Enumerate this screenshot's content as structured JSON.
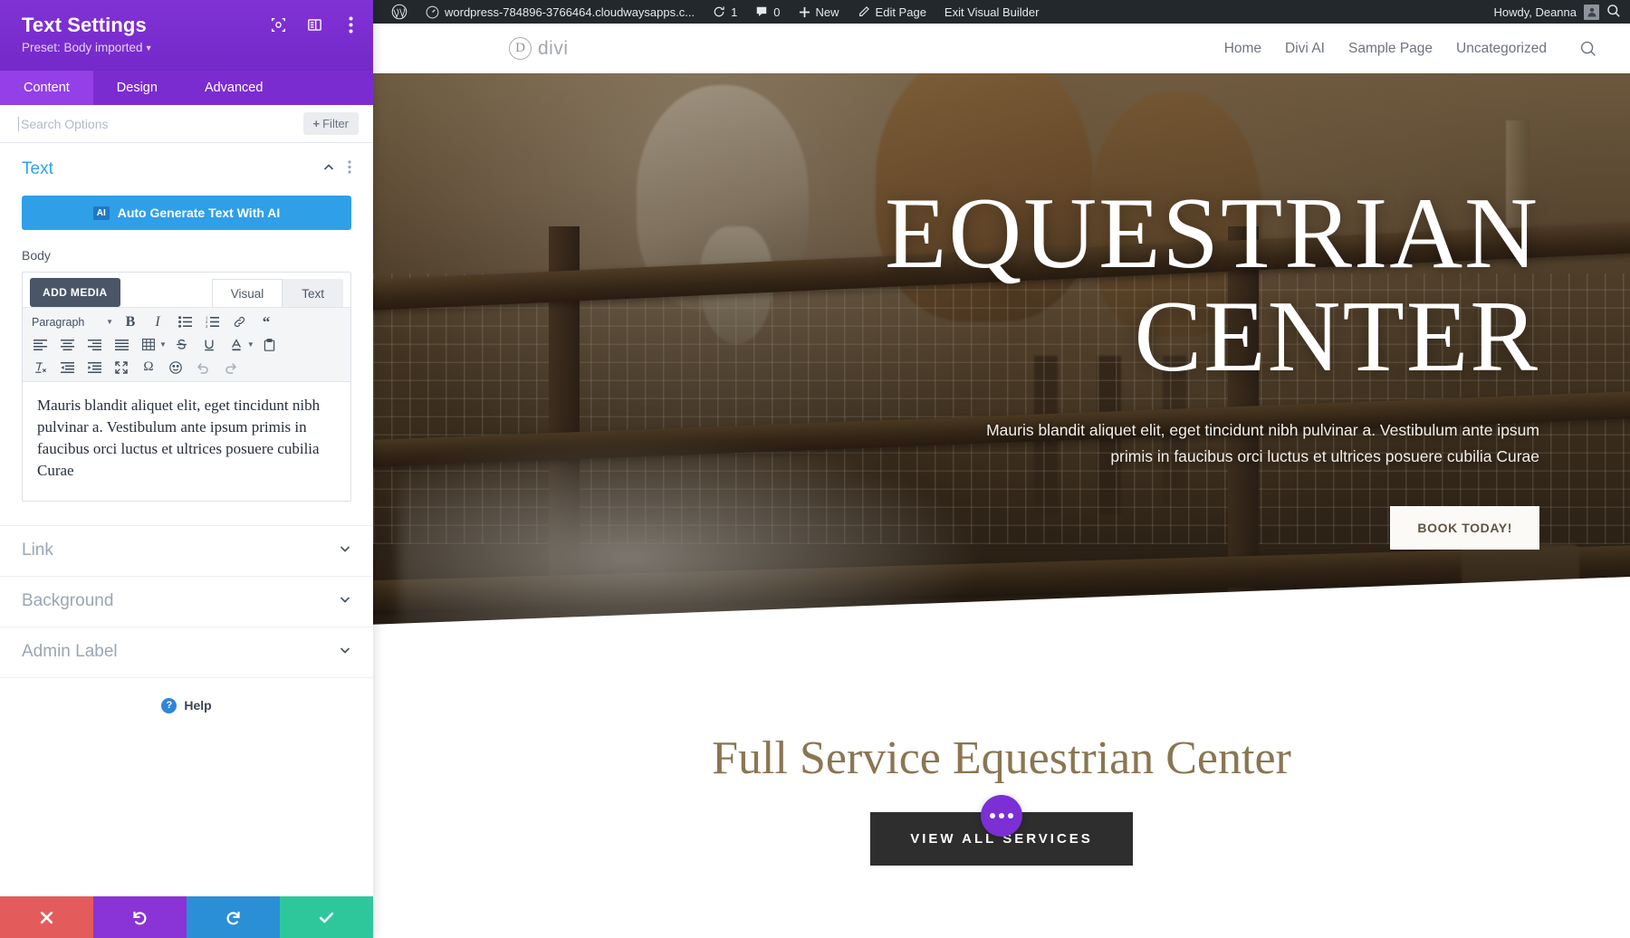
{
  "panel": {
    "title": "Text Settings",
    "preset": "Preset: Body imported",
    "header_icons": [
      "responsive-preview-icon",
      "layout-toggle-icon",
      "more-options-icon"
    ],
    "tabs": [
      {
        "label": "Content",
        "active": true
      },
      {
        "label": "Design",
        "active": false
      },
      {
        "label": "Advanced",
        "active": false
      }
    ],
    "search": {
      "placeholder": "Search Options",
      "value": ""
    },
    "filter_button": "Filter",
    "section_text": {
      "title": "Text",
      "ai_button": "Auto Generate Text With AI",
      "ai_badge": "AI",
      "field_label": "Body",
      "add_media": "ADD MEDIA",
      "editor_tabs": [
        {
          "label": "Visual",
          "active": true
        },
        {
          "label": "Text",
          "active": false
        }
      ],
      "format_select": "Paragraph",
      "toolbar_row1": [
        "bold-icon",
        "italic-icon",
        "bulleted-list-icon",
        "numbered-list-icon",
        "link-icon",
        "blockquote-icon"
      ],
      "toolbar_row2": [
        "align-left-icon",
        "align-center-icon",
        "align-right-icon",
        "align-justify-icon",
        "table-icon",
        "strikethrough-icon",
        "underline-icon",
        "text-color-icon",
        "paste-as-text-icon"
      ],
      "toolbar_row3": [
        "clear-formatting-icon",
        "outdent-icon",
        "indent-icon",
        "fullscreen-icon",
        "special-character-icon",
        "emoji-icon",
        "undo-icon",
        "redo-icon"
      ],
      "body_text": "Mauris blandit aliquet elit, eget tincidunt nibh pulvinar a. Vestibulum ante ipsum primis in faucibus orci luctus et ultrices posuere cubilia Curae"
    },
    "collapsed_sections": [
      {
        "label": "Link"
      },
      {
        "label": "Background"
      },
      {
        "label": "Admin Label"
      }
    ],
    "help_label": "Help",
    "footer_buttons": [
      {
        "name": "cancel",
        "icon": "close-icon"
      },
      {
        "name": "undo",
        "icon": "undo-icon"
      },
      {
        "name": "redo",
        "icon": "redo-icon"
      },
      {
        "name": "save",
        "icon": "check-icon"
      }
    ]
  },
  "adminbar": {
    "site_name": "wordpress-784896-3766464.cloudwaysapps.c...",
    "updates_count": "1",
    "comments_count": "0",
    "new_label": "New",
    "edit_page_label": "Edit Page",
    "exit_builder_label": "Exit Visual Builder",
    "howdy": "Howdy, Deanna"
  },
  "site": {
    "brand": "divi",
    "brand_mark": "D",
    "nav": [
      "Home",
      "Divi AI",
      "Sample Page",
      "Uncategorized"
    ],
    "hero": {
      "heading_line1": "EQUESTRIAN",
      "heading_line2": "CENTER",
      "paragraph": "Mauris blandit aliquet elit, eget tincidunt nibh pulvinar a. Vestibulum ante ipsum primis in faucibus orci luctus et ultrices posuere cubilia Curae",
      "button": "BOOK TODAY!"
    },
    "lower": {
      "heading": "Full Service Equestrian Center",
      "button": "VIEW ALL SERVICES"
    }
  },
  "colors": {
    "divi_purple": "#7b2fd4",
    "tab_active": "#9340e8",
    "accent_blue": "#2ea3f2",
    "ai_blue": "#2f9fe8",
    "brand_gold": "#8a7652",
    "cancel_red": "#e45b5b",
    "save_green": "#2ec79c",
    "adminbar_dark": "#23282d"
  }
}
